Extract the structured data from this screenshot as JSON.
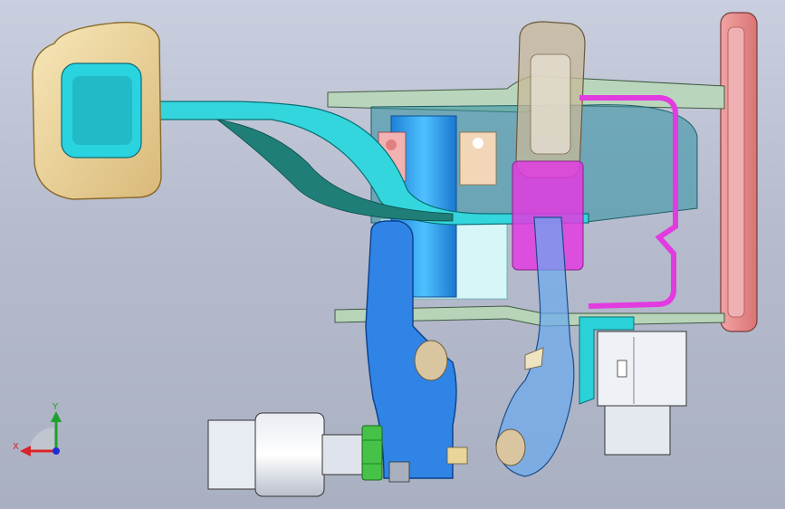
{
  "viewport": {
    "background_top": "#c9cfde",
    "background_bottom": "#a9b0c2"
  },
  "triad": {
    "x_label": "X",
    "y_label": "Y",
    "x_color": "#d8232a",
    "y_color": "#1fa12b",
    "z_color": "#1f2fd8"
  },
  "parts": [
    {
      "name": "pedal-pad",
      "color": "#e9d49a"
    },
    {
      "name": "pedal-arm",
      "color": "#2ad1d6"
    },
    {
      "name": "firewall-plate",
      "color": "#e88f8f"
    },
    {
      "name": "pivot-shaft",
      "color": "#2fa6ec"
    },
    {
      "name": "lower-lever",
      "color": "#2b7fe0"
    },
    {
      "name": "sensor-link",
      "color": "#6aa9f0"
    },
    {
      "name": "spring-clip",
      "color": "#e23be0"
    },
    {
      "name": "bump-stop",
      "color": "#d9c6a0"
    },
    {
      "name": "switch-connector",
      "color": "#e9eef5"
    },
    {
      "name": "stop-lamp-switch",
      "color": "#d8dde6"
    },
    {
      "name": "lock-nut",
      "color": "#3fbf3f"
    }
  ]
}
